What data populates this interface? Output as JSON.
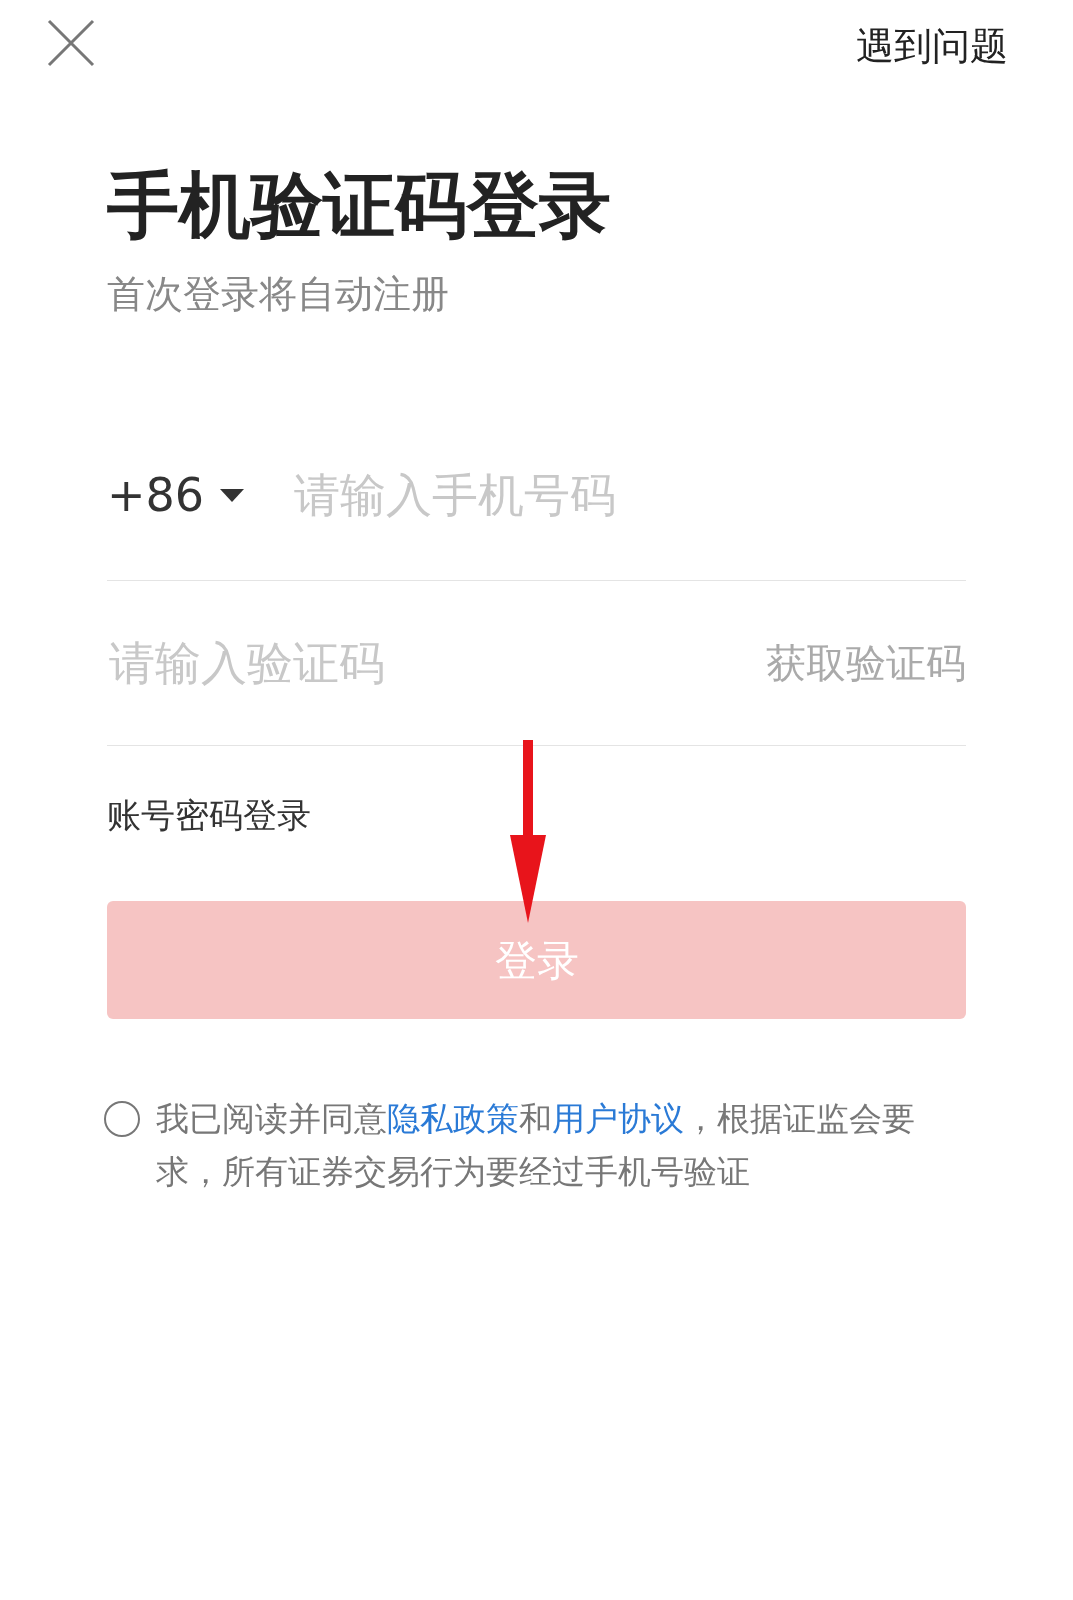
{
  "top_bar": {
    "help": "遇到问题"
  },
  "title": "手机验证码登录",
  "subtitle": "首次登录将自动注册",
  "phone": {
    "country_code": "+86",
    "placeholder": "请输入手机号码"
  },
  "code": {
    "placeholder": "请输入验证码",
    "get_code": "获取验证码"
  },
  "password_login": "账号密码登录",
  "login_button": {
    "label": "登录",
    "disabled": true
  },
  "agreement": {
    "checked": false,
    "parts": [
      {
        "kind": "text",
        "text": "我已阅读并同意"
      },
      {
        "kind": "link",
        "text": "隐私政策"
      },
      {
        "kind": "text",
        "text": "和"
      },
      {
        "kind": "link",
        "text": "用户协议"
      },
      {
        "kind": "text",
        "text": "，根据证监会要求，所有证券交易行为要经过手机号验证"
      }
    ]
  }
}
